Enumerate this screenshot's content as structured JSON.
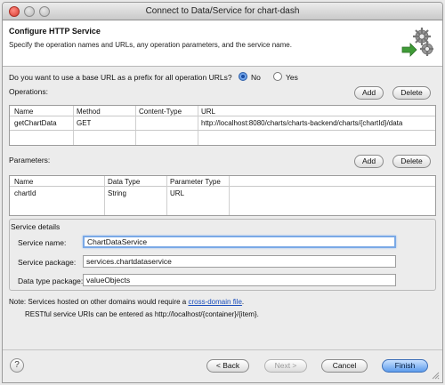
{
  "window": {
    "title": "Connect to Data/Service for chart-dash"
  },
  "header": {
    "title": "Configure HTTP Service",
    "subtitle": "Specify the operation names and URLs, any operation parameters, and the service name.",
    "icon": "gears-icon"
  },
  "base_url": {
    "question": "Do you want to use a base URL as a prefix for all operation URLs?",
    "options": [
      {
        "label": "No",
        "selected": true
      },
      {
        "label": "Yes",
        "selected": false
      }
    ]
  },
  "operations": {
    "label": "Operations:",
    "add_label": "Add",
    "delete_label": "Delete",
    "columns": [
      "Name",
      "Method",
      "Content-Type",
      "URL"
    ],
    "rows": [
      {
        "name": "getChartData",
        "method": "GET",
        "content_type": "",
        "url": "http://localhost:8080/charts/charts-backend/charts/{chartId}/data"
      }
    ]
  },
  "parameters": {
    "label": "Parameters:",
    "add_label": "Add",
    "delete_label": "Delete",
    "columns": [
      "Name",
      "Data Type",
      "Parameter Type"
    ],
    "rows": [
      {
        "name": "chartId",
        "data_type": "String",
        "parameter_type": "URL"
      }
    ]
  },
  "service_details": {
    "title": "Service details",
    "name_label": "Service name:",
    "name_value": "ChartDataService",
    "package_label": "Service package:",
    "package_value": "services.chartdataservice",
    "datatype_label": "Data type package:",
    "datatype_value": "valueObjects"
  },
  "notes": {
    "line1_prefix": "Note: Services hosted on other domains would require a ",
    "line1_link": "cross-domain file",
    "line1_suffix": ".",
    "line2": "RESTful service URIs can be entered as http://localhost/{container}/{item}."
  },
  "footer": {
    "help_glyph": "?",
    "back_label": "< Back",
    "next_label": "Next >",
    "cancel_label": "Cancel",
    "finish_label": "Finish"
  },
  "colors": {
    "accent": "#3d7bd6",
    "link": "#1a4dbb"
  }
}
